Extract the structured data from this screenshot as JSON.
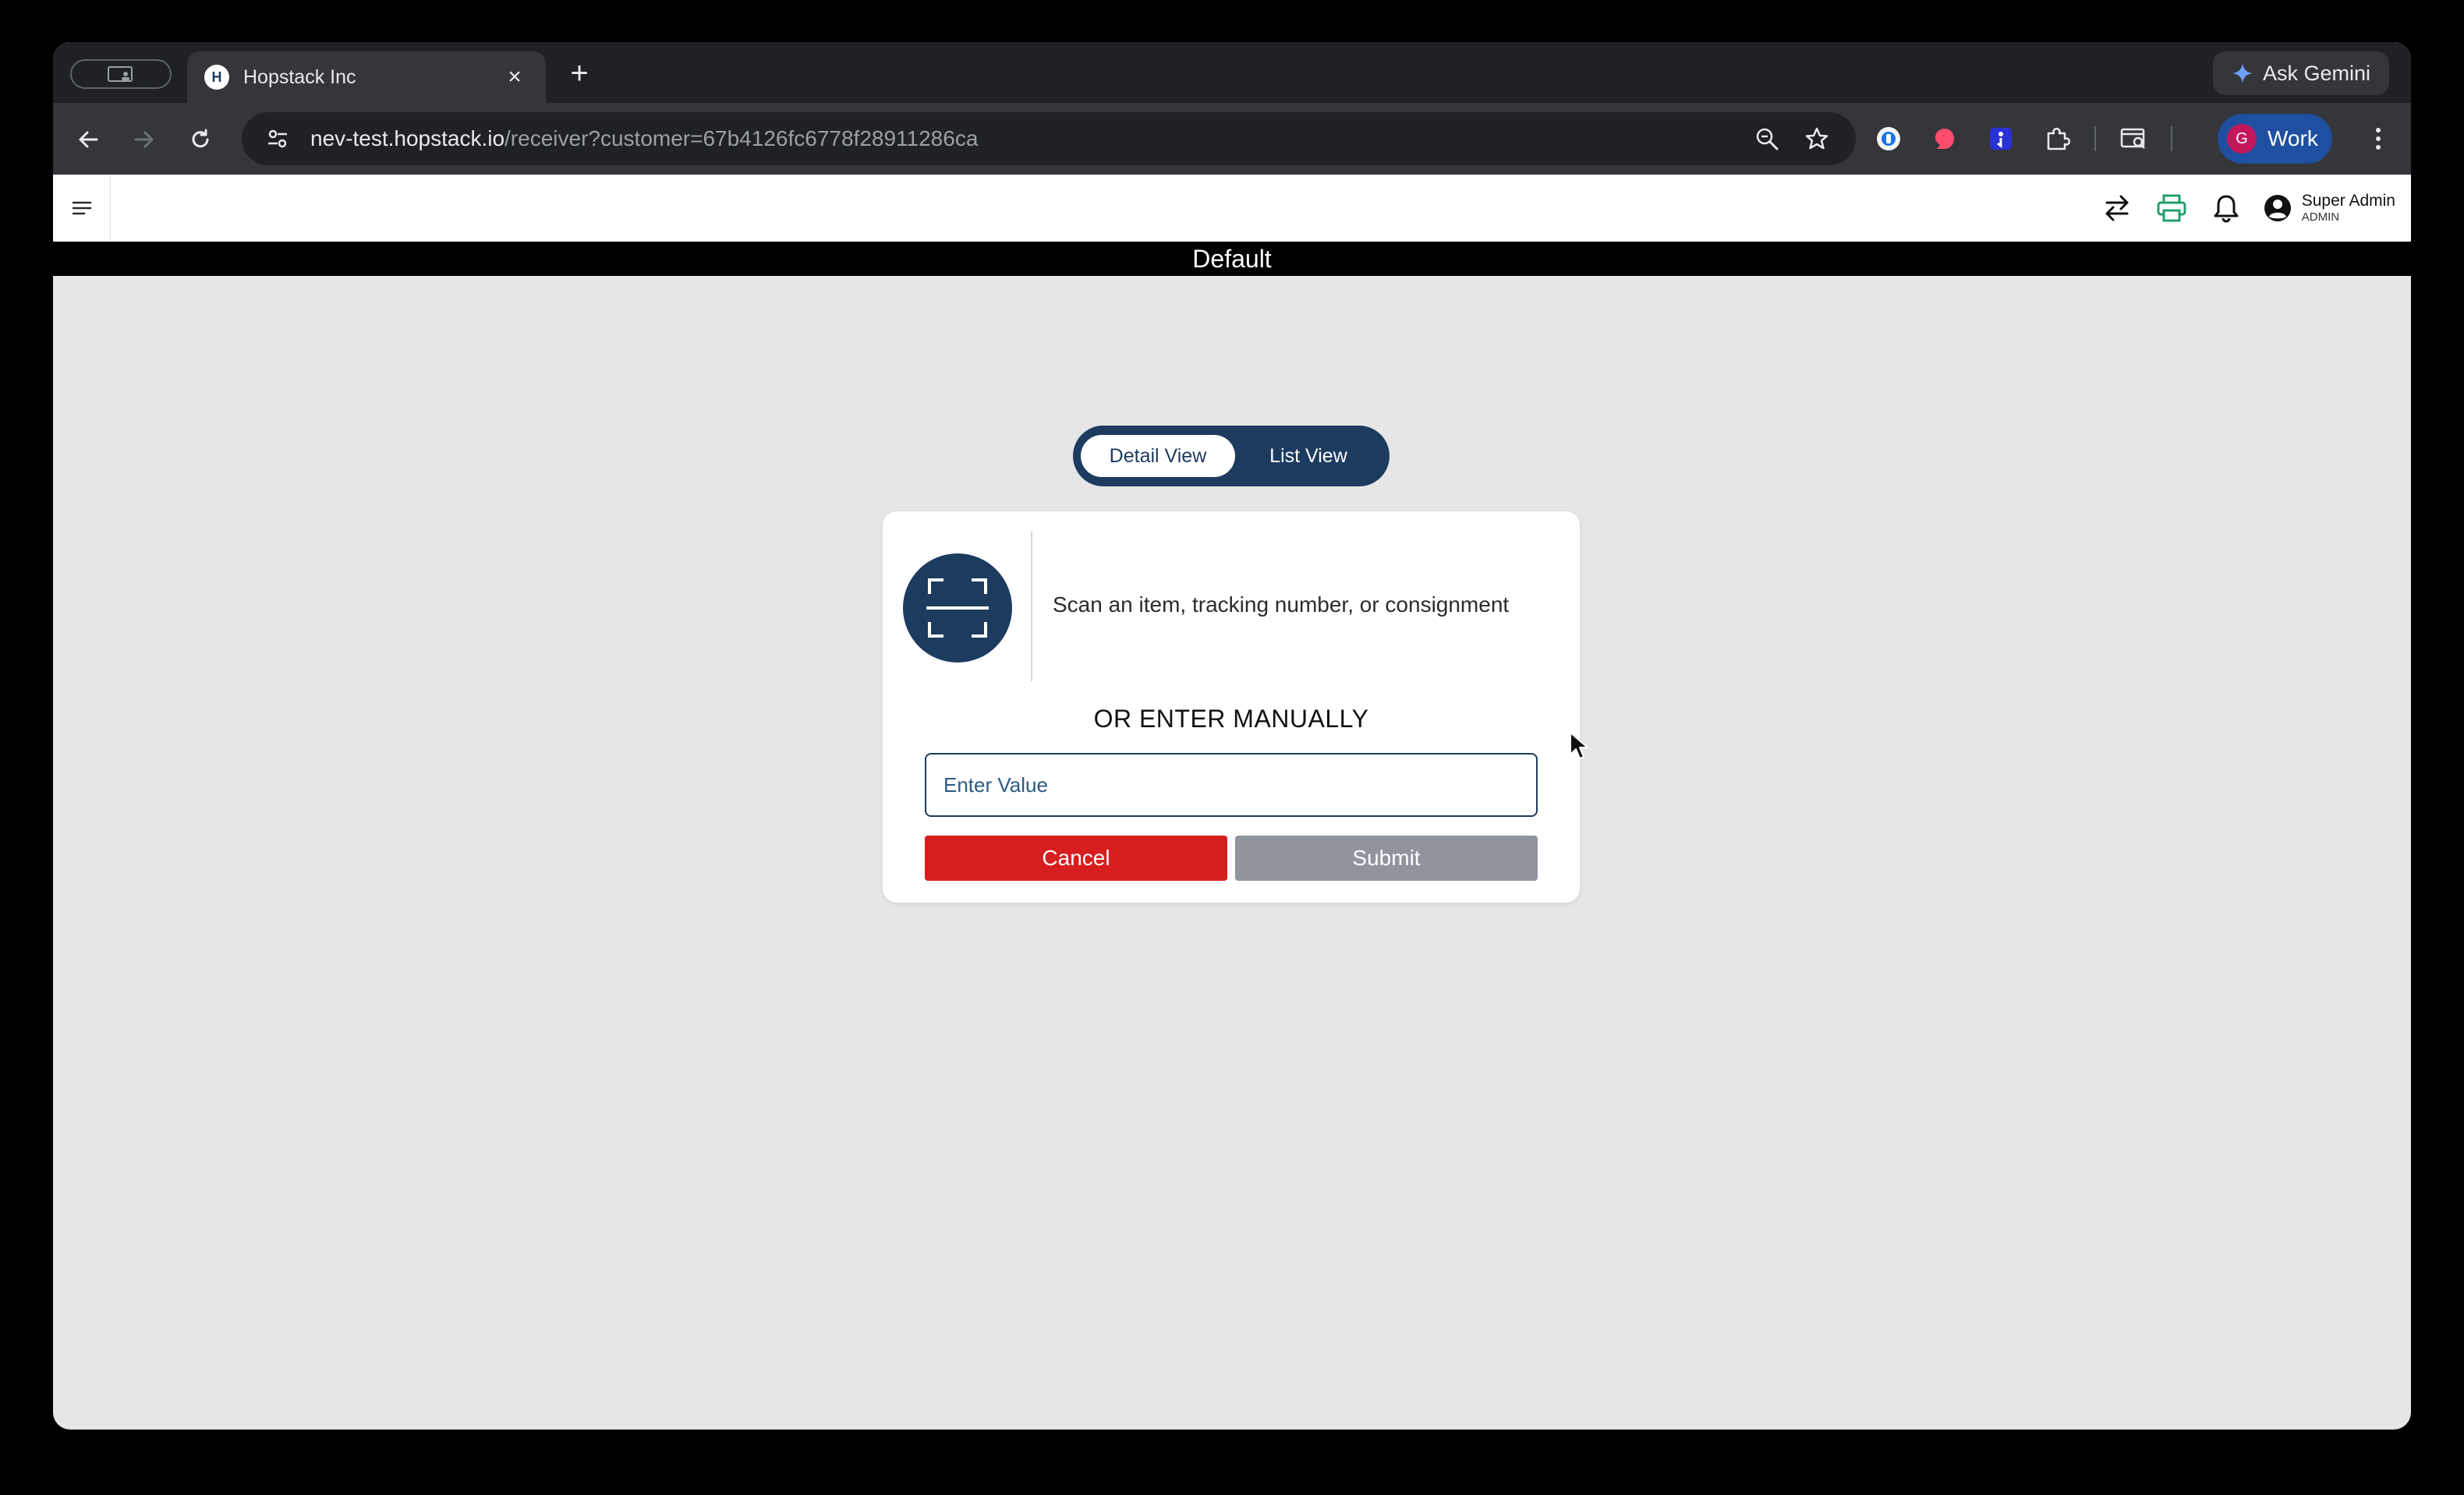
{
  "browser": {
    "tab_title": "Hopstack Inc",
    "tab_favicon_letter": "H",
    "tab_close": "×",
    "new_tab": "+",
    "ask_gemini": "Ask Gemini",
    "url_host": "nev-test.hopstack.io",
    "url_path": "/receiver?customer=67b4126fc6778f28911286ca",
    "profile_label": "Work",
    "profile_initial": "G"
  },
  "header": {
    "user_name": "Super Admin",
    "user_role": "ADMIN",
    "printer_color": "#22a06b"
  },
  "banner": {
    "title": "Default"
  },
  "view_toggle": {
    "detail": "Detail View",
    "list": "List View",
    "active": "detail"
  },
  "scan_card": {
    "instruction": "Scan an item, tracking number, or consignment",
    "or_label": "OR ENTER MANUALLY",
    "input_placeholder": "Enter Value",
    "input_value": "",
    "cancel_label": "Cancel",
    "submit_label": "Submit"
  },
  "colors": {
    "primary": "#1d3b5f",
    "cancel": "#d71e1e",
    "submit_disabled": "#8f949d",
    "background": "#e6e6e6"
  }
}
